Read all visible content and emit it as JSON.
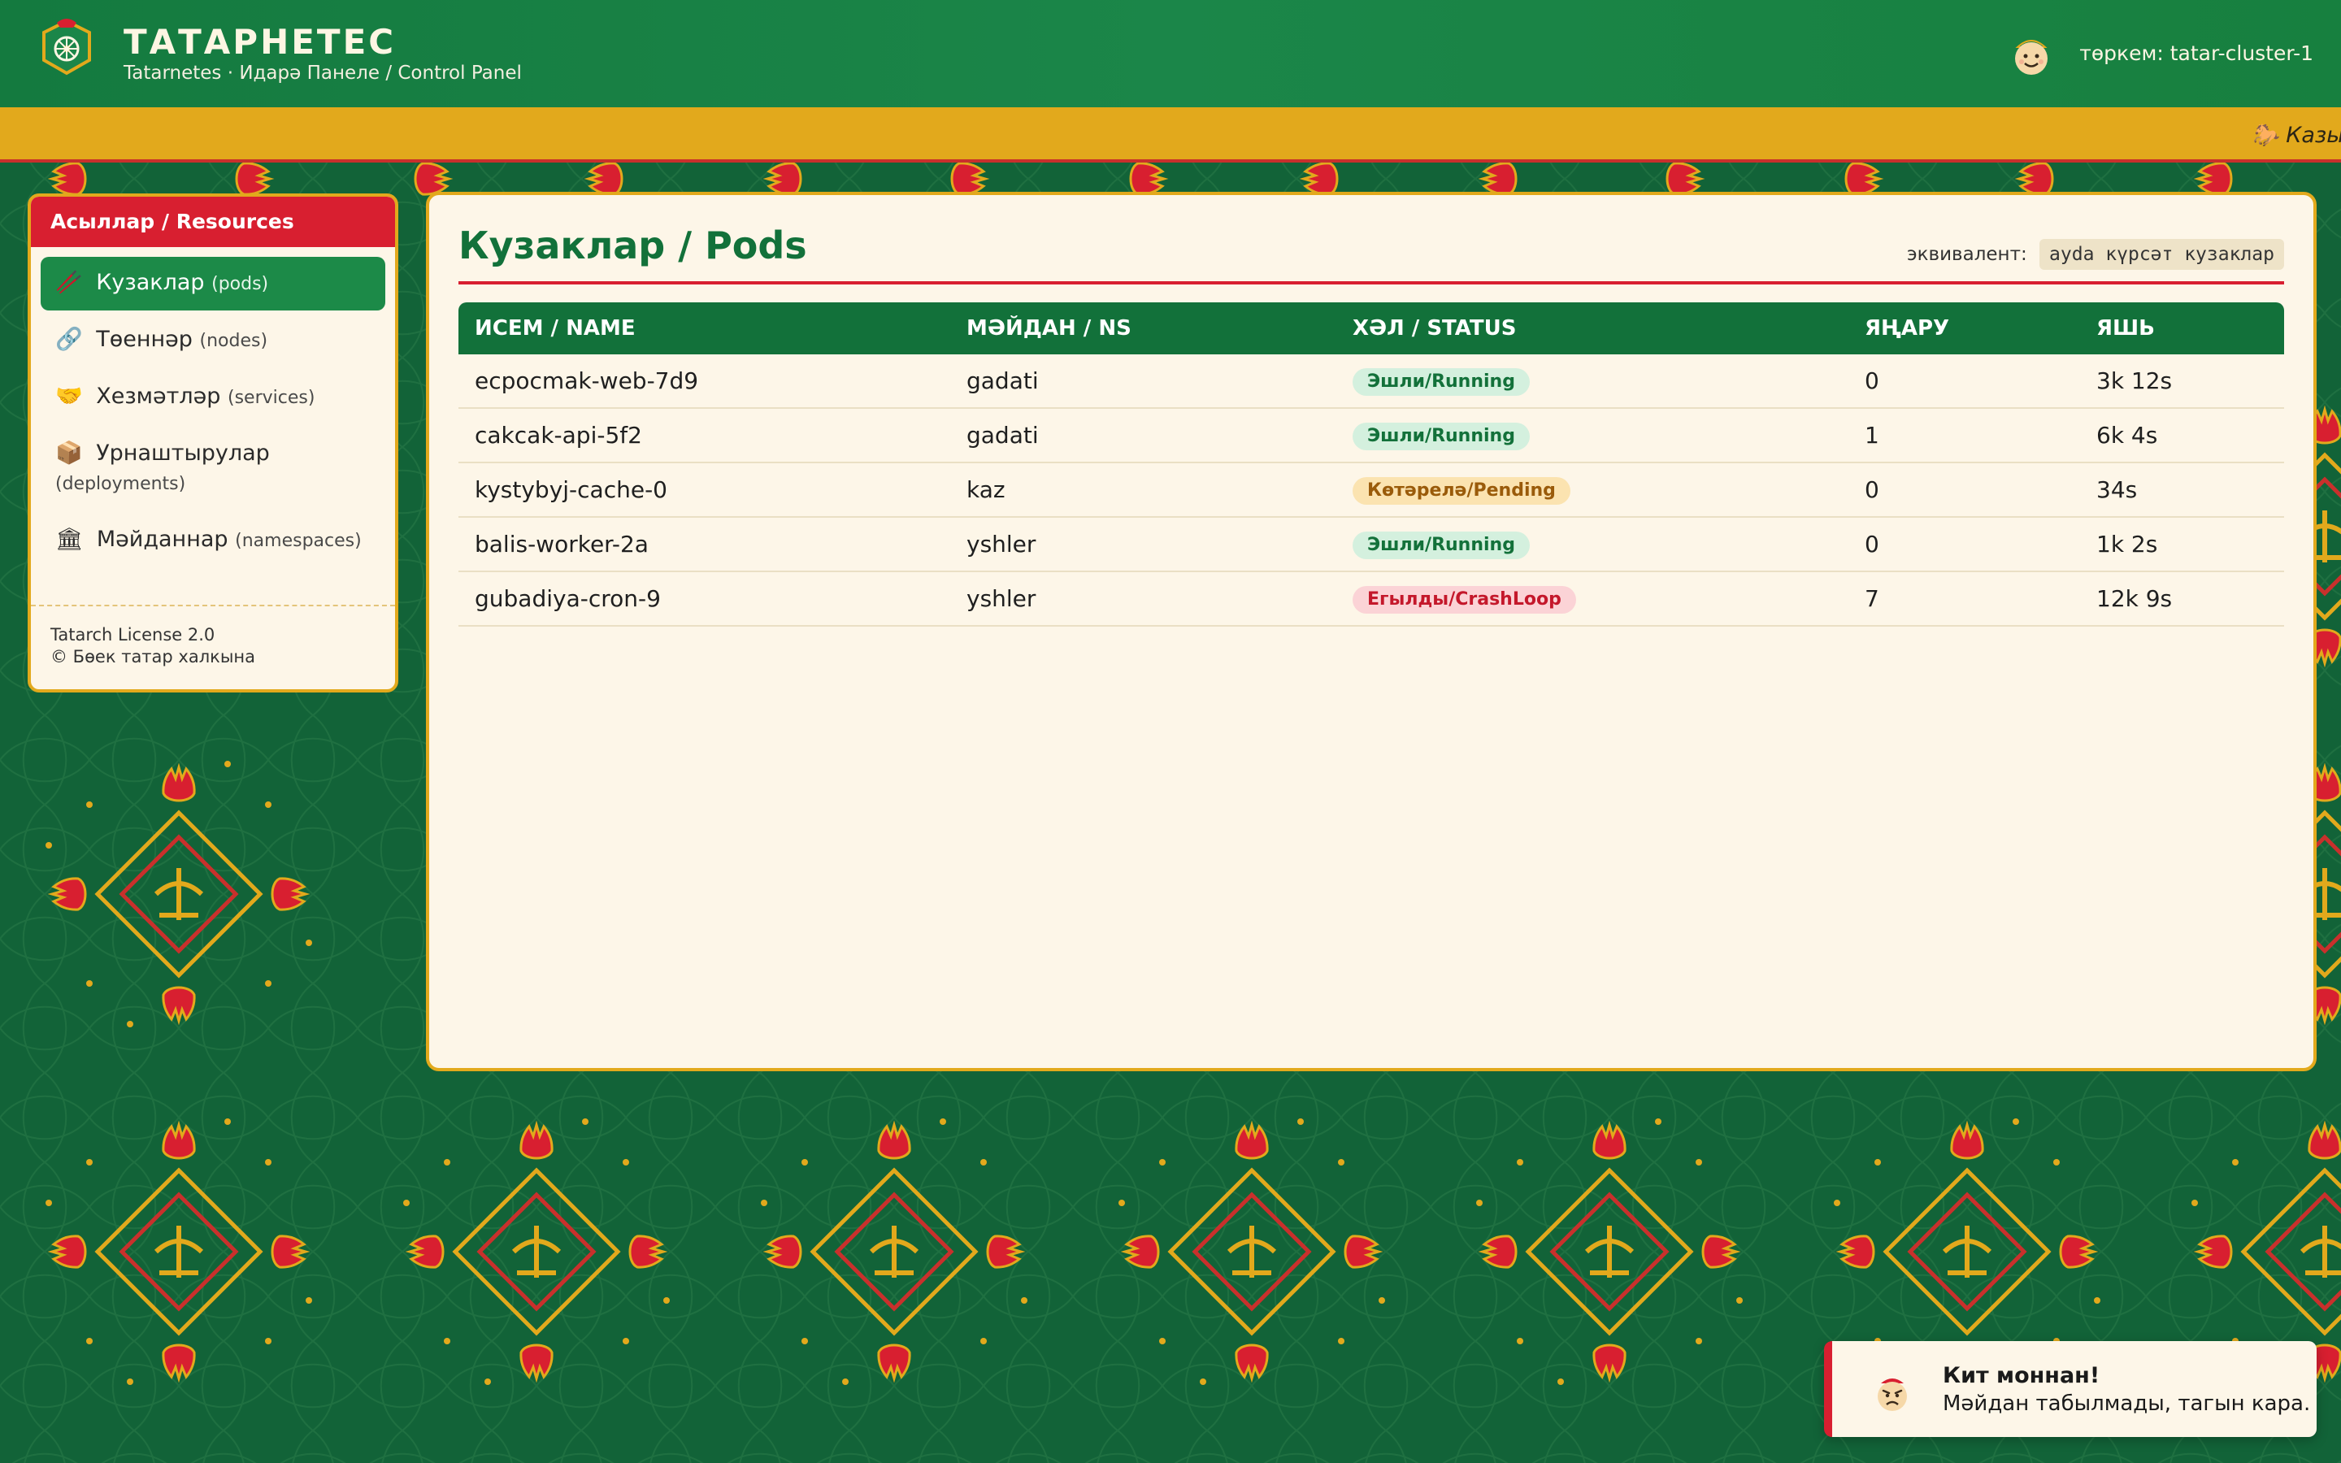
{
  "header": {
    "title": "ТАТАРНЕТЕС",
    "subtitle": "Tatarnetes · Идарә Панеле / Control Panel",
    "cluster_label": "төркем: tatar-cluster-1"
  },
  "ticker": {
    "text": "🐎 Казыл"
  },
  "sidebar": {
    "heading": "Асыллар / Resources",
    "items": [
      {
        "icon": "🥢",
        "icon_name": "pod-icon",
        "label": "Кузаклар",
        "sub": "(pods)",
        "active": true
      },
      {
        "icon": "🔗",
        "icon_name": "link-icon",
        "label": "Төеннәр",
        "sub": "(nodes)",
        "active": false
      },
      {
        "icon": "🤝",
        "icon_name": "handshake-icon",
        "label": "Хезмәтләр",
        "sub": "(services)",
        "active": false
      },
      {
        "icon": "📦",
        "icon_name": "package-icon",
        "label": "Урнаштырулар",
        "sub": "(deployments)",
        "active": false
      },
      {
        "icon": "🏛",
        "icon_name": "building-icon",
        "label": "Мәйданнар",
        "sub": "(namespaces)",
        "active": false
      }
    ],
    "footer_license": "Tatarch License 2.0",
    "footer_copyright": "© Бөек татар халкына"
  },
  "main": {
    "title": "Кузаклар / Pods",
    "equivalent_label": "эквивалент:",
    "equivalent_command": "ayda күрсәт кузаклар",
    "columns": [
      "ИСЕМ / NAME",
      "МӘЙДАН / NS",
      "ХӘЛ / STATUS",
      "ЯҢАРУ",
      "ЯШЬ"
    ],
    "rows": [
      {
        "name": "ecpocmak-web-7d9",
        "ns": "gadati",
        "status": "Эшли/Running",
        "status_kind": "running",
        "restarts": "0",
        "age": "3k 12s"
      },
      {
        "name": "cakcak-api-5f2",
        "ns": "gadati",
        "status": "Эшли/Running",
        "status_kind": "running",
        "restarts": "1",
        "age": "6k 4s"
      },
      {
        "name": "kystybyj-cache-0",
        "ns": "kaz",
        "status": "Көтәрелә/Pending",
        "status_kind": "pending",
        "restarts": "0",
        "age": "34s"
      },
      {
        "name": "balis-worker-2a",
        "ns": "yshler",
        "status": "Эшли/Running",
        "status_kind": "running",
        "restarts": "0",
        "age": "1k 2s"
      },
      {
        "name": "gubadiya-cron-9",
        "ns": "yshler",
        "status": "Егылды/CrashLoop",
        "status_kind": "crash",
        "restarts": "7",
        "age": "12k 9s"
      }
    ]
  },
  "toast": {
    "title": "Кит моннан!",
    "message": "Мәйдан табылмады, тагын кара."
  },
  "colors": {
    "brand_green": "#12713a",
    "header_green": "#1b8649",
    "accent_red": "#d81f30",
    "accent_gold": "#e2a91c",
    "panel_cream": "#fdf6e8",
    "background_green": "#126338"
  }
}
